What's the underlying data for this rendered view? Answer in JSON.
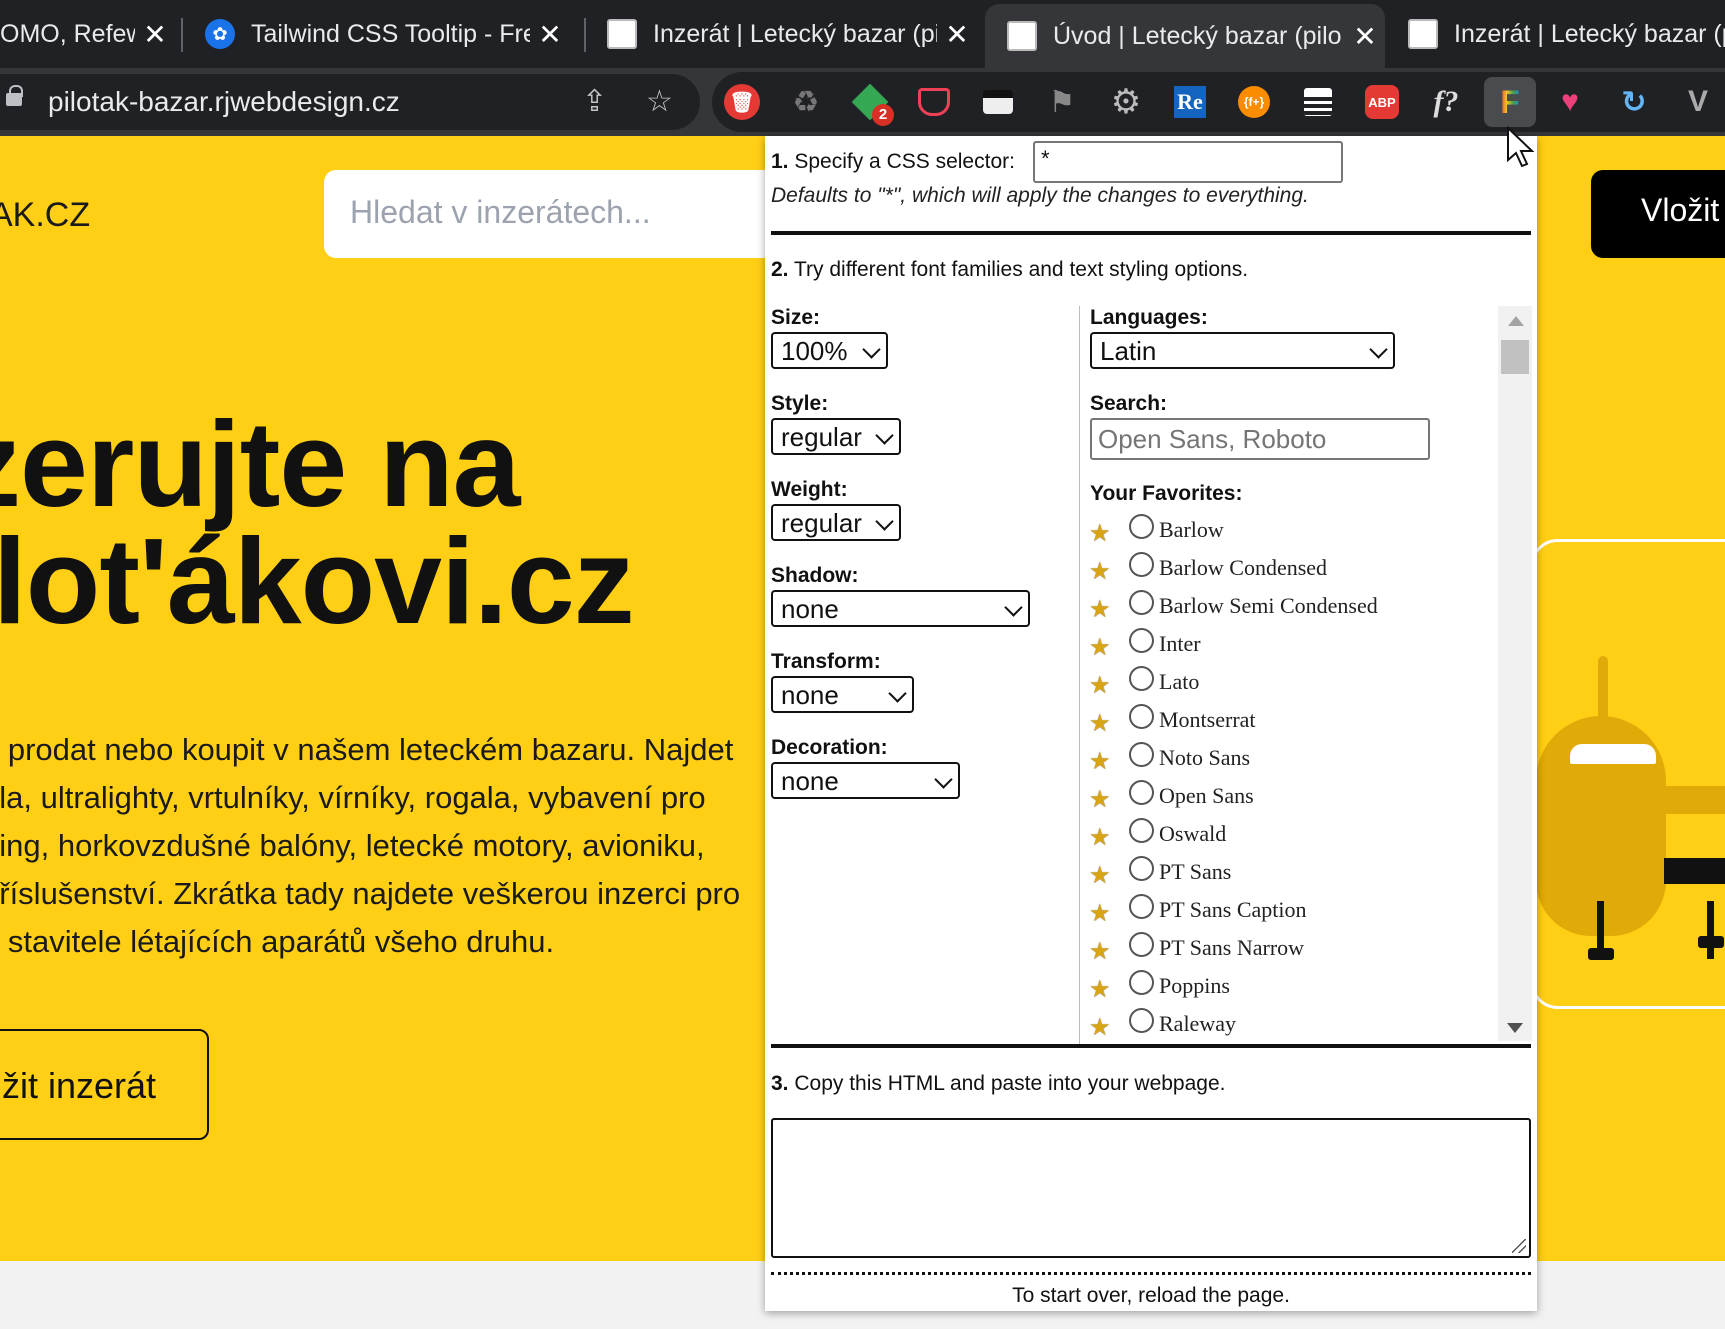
{
  "tabs": [
    {
      "title": "OMO, Refew",
      "favicon": ""
    },
    {
      "title": "Tailwind CSS Tooltip - Free",
      "favicon": "tailwind-icon"
    },
    {
      "title": "Inzerát | Letecký bazar (pi",
      "favicon": "page-icon"
    },
    {
      "title": "Úvod | Letecký bazar (pilo",
      "favicon": "page-icon",
      "active": true
    },
    {
      "title": "Inzerát | Letecký bazar (pi",
      "favicon": "page-icon"
    }
  ],
  "tab_close": "✕",
  "address": {
    "url": "pilotak-bazar.rjwebdesign.cz"
  },
  "extensions": {
    "badge": "2",
    "re": "Re",
    "ft": "{f+}",
    "abp": "ABP",
    "fq": "f?"
  },
  "page": {
    "logo": "AK.CZ",
    "search_placeholder": "Hledat v inzerátech...",
    "post_button": "Vložit",
    "hero_line1": "zerujte na",
    "hero_line2": "ilot'ákovi.cz",
    "desc_lines": [
      "e prodat nebo koupit v našem leteckém bazaru. Najdet",
      "dla, ultralighty, vrtulníky, vírníky, rogala, vybavení pro",
      "ding, horkovzdušné balóny, letecké motory, avioniku,",
      "příslušenství. Zkrátka tady najdete veškerou inzerci pro",
      "a stavitele létajících aparátů všeho druhu."
    ],
    "cta": "žit inzerát"
  },
  "popup": {
    "step1_num": "1.",
    "step1": "Specify a CSS selector:",
    "selector_value": "*",
    "step1_note": "Defaults to \"*\", which will apply the changes to everything.",
    "step2_num": "2.",
    "step2": "Try different font families and text styling options.",
    "size_label": "Size:",
    "size_value": "100%",
    "style_label": "Style:",
    "style_value": "regular",
    "weight_label": "Weight:",
    "weight_value": "regular",
    "shadow_label": "Shadow:",
    "shadow_value": "none",
    "transform_label": "Transform:",
    "transform_value": "none",
    "decoration_label": "Decoration:",
    "decoration_value": "none",
    "languages_label": "Languages:",
    "languages_value": "Latin",
    "search_label": "Search:",
    "search_placeholder": "Open Sans, Roboto",
    "favorites_label": "Your Favorites:",
    "favorites": [
      "Barlow",
      "Barlow Condensed",
      "Barlow Semi Condensed",
      "Inter",
      "Lato",
      "Montserrat",
      "Noto Sans",
      "Open Sans",
      "Oswald",
      "PT Sans",
      "PT Sans Caption",
      "PT Sans Narrow",
      "Poppins",
      "Raleway"
    ],
    "step3_num": "3.",
    "step3": "Copy this HTML and paste into your webpage.",
    "footer": "To start over, reload the page."
  },
  "colors": {
    "accent": "#ffcf16",
    "tabbar": "#202124",
    "toolbar": "#35363a"
  }
}
